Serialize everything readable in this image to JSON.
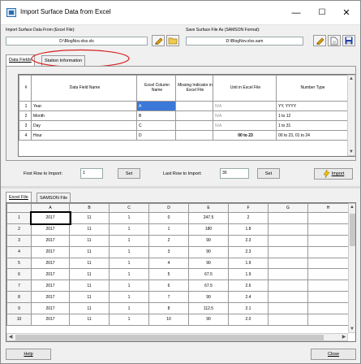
{
  "window": {
    "title": "Import Surface Data from Excel",
    "minimize": "—",
    "maximize": "☐",
    "close": "✕"
  },
  "import_from": {
    "label": "Import Surface Data From (Excel File):",
    "value": "D:\\BlogNov.xlsx.xls"
  },
  "save_as": {
    "label": "Save Surface File As (SAMSON Format):",
    "value": "D:\\BlogNov.xlsx.sam"
  },
  "tabs": [
    "Data Fields",
    "Station Information"
  ],
  "field_table": {
    "headers": [
      "#",
      "Data Field Name",
      "Excel Column Name",
      "Missing Indicator in Excel File",
      "Unit in Excel File",
      "Number Type"
    ],
    "rows": [
      {
        "num": "1",
        "name": "Year",
        "col": "A",
        "missing": "",
        "unit": "N/A",
        "type": "YY, YYYY"
      },
      {
        "num": "2",
        "name": "Month",
        "col": "B",
        "missing": "",
        "unit": "N/A",
        "type": "1 to 12"
      },
      {
        "num": "3",
        "name": "Day",
        "col": "C",
        "missing": "",
        "unit": "N/A",
        "type": "1 to 31"
      },
      {
        "num": "4",
        "name": "Hour",
        "col": "D",
        "missing": "",
        "unit": "00 to 23",
        "type": "00 to 23, 01 to 24"
      }
    ]
  },
  "first_row": {
    "label": "First Row to Import:",
    "value": "1",
    "set": "Set"
  },
  "last_row": {
    "label": "Last Row to Import:",
    "value": "30",
    "set": "Set"
  },
  "import_button": "Import",
  "bottom_tabs": [
    "Excel File",
    "SAMSON File"
  ],
  "sheet": {
    "columns": [
      "A",
      "B",
      "C",
      "D",
      "E",
      "F",
      "G",
      "H"
    ],
    "rows": [
      [
        "1",
        "2017",
        "11",
        "1",
        "0",
        "247.5",
        "2",
        "",
        ""
      ],
      [
        "2",
        "2017",
        "11",
        "1",
        "1",
        "180",
        "1.8",
        "",
        ""
      ],
      [
        "3",
        "2017",
        "11",
        "1",
        "2",
        "90",
        "2.3",
        "",
        ""
      ],
      [
        "4",
        "2017",
        "11",
        "1",
        "3",
        "90",
        "2.3",
        "",
        ""
      ],
      [
        "5",
        "2017",
        "11",
        "1",
        "4",
        "90",
        "1.9",
        "",
        ""
      ],
      [
        "6",
        "2017",
        "11",
        "1",
        "5",
        "67.5",
        "1.9",
        "",
        ""
      ],
      [
        "7",
        "2017",
        "11",
        "1",
        "6",
        "67.5",
        "2.6",
        "",
        ""
      ],
      [
        "8",
        "2017",
        "11",
        "1",
        "7",
        "90",
        "2.4",
        "",
        ""
      ],
      [
        "9",
        "2017",
        "11",
        "1",
        "8",
        "112.5",
        "2.1",
        "",
        ""
      ],
      [
        "10",
        "2017",
        "11",
        "1",
        "10",
        "90",
        "2.0",
        "",
        ""
      ]
    ]
  },
  "help_button": "Help",
  "close_button": "Close",
  "annotation_color": "#d62020",
  "accent": "#2b6cb0"
}
